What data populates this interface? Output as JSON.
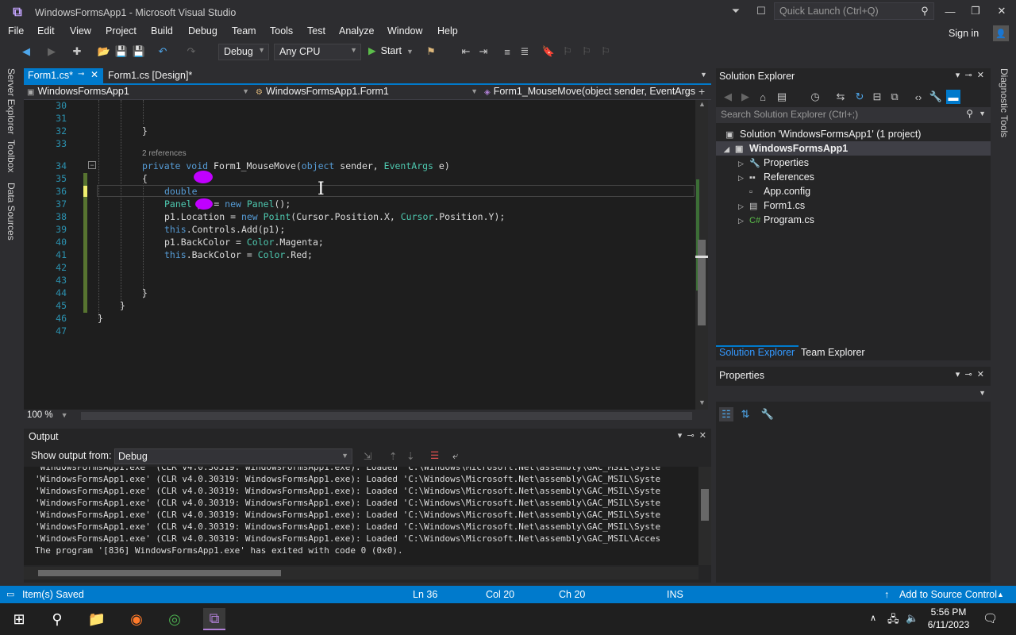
{
  "window": {
    "title": "WindowsFormsApp1 - Microsoft Visual Studio",
    "quick_launch_placeholder": "Quick Launch (Ctrl+Q)"
  },
  "menu": [
    "File",
    "Edit",
    "View",
    "Project",
    "Build",
    "Debug",
    "Team",
    "Tools",
    "Test",
    "Analyze",
    "Window",
    "Help"
  ],
  "sign_in": "Sign in",
  "toolbar": {
    "config": "Debug",
    "platform": "Any CPU",
    "start": "Start"
  },
  "left_tabs": [
    "Server Explorer",
    "Toolbox",
    "Data Sources"
  ],
  "right_tabs": [
    "Diagnostic Tools"
  ],
  "editor": {
    "tabs": [
      {
        "label": "Form1.cs*",
        "active": true
      },
      {
        "label": "Form1.cs [Design]*",
        "active": false
      }
    ],
    "nav": {
      "project": "WindowsFormsApp1",
      "class": "WindowsFormsApp1.Form1",
      "member": "Form1_MouseMove(object sender, EventArgs e)"
    },
    "codelens": "2 references",
    "line_numbers": [
      "30",
      "31",
      "32",
      "33",
      "34",
      "35",
      "36",
      "37",
      "38",
      "39",
      "40",
      "41",
      "42",
      "43",
      "44",
      "45",
      "46",
      "47"
    ],
    "lines": {
      "l32": "}",
      "l34a": "private void",
      "l34b": " Form1_MouseMove(",
      "l34c": "object",
      "l34d": " sender, ",
      "l34e": "EventArgs",
      "l34f": " e)",
      "l35": "{",
      "l36": "double",
      "l37a": "Panel",
      "l37b": " p1 = ",
      "l37c": "new",
      "l37d": " Panel",
      "l37e": "();",
      "l38a": "p1.Location = ",
      "l38b": "new",
      "l38c": " Point",
      "l38d": "(Cursor",
      "l38e": ".Position.X, ",
      "l38f": "Cursor",
      "l38g": ".Position.Y);",
      "l39a": "this",
      "l39b": ".Controls.Add(p1);",
      "l40a": "p1.BackColor = ",
      "l40b": "Color",
      "l40c": ".Magenta;",
      "l41a": "this",
      "l41b": ".BackColor = ",
      "l41c": "Color",
      "l41d": ".Red;",
      "l44": "}",
      "l45": "}",
      "l46": "}"
    },
    "zoom": "100 %"
  },
  "output": {
    "title": "Output",
    "show_from_label": "Show output from:",
    "source": "Debug",
    "lines": [
      "'WindowsFormsApp1.exe' (CLR v4.0.30319: WindowsFormsApp1.exe): Loaded 'C:\\Windows\\Microsoft.Net\\assembly\\GAC_MSIL\\Syste",
      "'WindowsFormsApp1.exe' (CLR v4.0.30319: WindowsFormsApp1.exe): Loaded 'C:\\Windows\\Microsoft.Net\\assembly\\GAC_MSIL\\Syste",
      "'WindowsFormsApp1.exe' (CLR v4.0.30319: WindowsFormsApp1.exe): Loaded 'C:\\Windows\\Microsoft.Net\\assembly\\GAC_MSIL\\Syste",
      "'WindowsFormsApp1.exe' (CLR v4.0.30319: WindowsFormsApp1.exe): Loaded 'C:\\Windows\\Microsoft.Net\\assembly\\GAC_MSIL\\Syste",
      "'WindowsFormsApp1.exe' (CLR v4.0.30319: WindowsFormsApp1.exe): Loaded 'C:\\Windows\\Microsoft.Net\\assembly\\GAC_MSIL\\Syste",
      "'WindowsFormsApp1.exe' (CLR v4.0.30319: WindowsFormsApp1.exe): Loaded 'C:\\Windows\\Microsoft.Net\\assembly\\GAC_MSIL\\Acces",
      "The program '[836] WindowsFormsApp1.exe' has exited with code 0 (0x0)."
    ]
  },
  "solution_explorer": {
    "title": "Solution Explorer",
    "search_placeholder": "Search Solution Explorer (Ctrl+;)",
    "solution": "Solution 'WindowsFormsApp1' (1 project)",
    "project": "WindowsFormsApp1",
    "items": [
      "Properties",
      "References",
      "App.config",
      "Form1.cs",
      "Program.cs"
    ],
    "tabs": [
      "Solution Explorer",
      "Team Explorer"
    ]
  },
  "properties": {
    "title": "Properties"
  },
  "status": {
    "message": "Item(s) Saved",
    "ln": "Ln 36",
    "col": "Col 20",
    "ch": "Ch 20",
    "mode": "INS",
    "source_control": "Add to Source Control"
  },
  "taskbar": {
    "time": "5:56 PM",
    "date": "6/11/2023"
  },
  "colors": {
    "accent": "#007acc",
    "keyword": "#569cd6",
    "type": "#4ec9b0",
    "marker": "#c000ff"
  }
}
